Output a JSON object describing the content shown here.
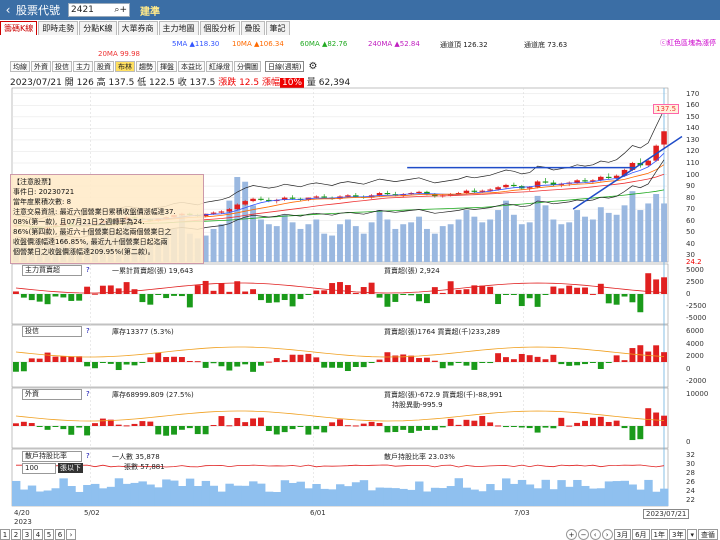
{
  "header": {
    "back_icon": "‹",
    "title": "股票代號",
    "code": "2421",
    "stock_name": "建準"
  },
  "tabs": [
    "籌碼K線",
    "即時走勢",
    "分點K線",
    "大單券商",
    "主力地圖",
    "個股分析",
    "疊股",
    "筆記"
  ],
  "ma": {
    "ma5": "5MA ▲118.30",
    "ma10": "10MA ▲106.34",
    "ma60": "60MA ▲82.76",
    "ma240": "240MA ▲52.84",
    "ch_top": "通道頂 126.32",
    "ch_bot": "通道底 73.63",
    "ma20": "20MA 99.98",
    "mark": "ⓒ紅色區塊為漲停",
    "colors": {
      "ma5": "#3355ff",
      "ma10": "#ff6a00",
      "ma60": "#22aa22",
      "ma240": "#c020c0",
      "ma20": "#ee3333",
      "ch": "#222222"
    }
  },
  "toolbar": {
    "buttons": [
      "均線",
      "外資",
      "投信",
      "主力",
      "股資",
      "布林",
      "趨勢",
      "揮盤",
      "本益比",
      "紅綠燈",
      "分價圖"
    ],
    "selected": "布林",
    "period": "日線(週期)"
  },
  "quote": {
    "date": "2023/07/21",
    "open": "開 126",
    "high": "高 137.5",
    "low": "低 122.5",
    "close": "收 137.5",
    "change": "漲跌 12.5",
    "pct_label": "漲幅",
    "pct": "10%",
    "volume": "量 62,394"
  },
  "note": {
    "lines": [
      "【注意股票】",
      "事件日: 20230721",
      "當年度累積次數: 8",
      "注意交易資訊: 最近六個營業日累積收盤價漲幅達37.",
      "08%(第一款), 且07月21日之週轉率為24.",
      "86%(第四款), 最近六十個營業日起迄兩個營業日之",
      "收盤價漲幅達166.85%, 最近九十個營業日起迄兩",
      "個營業日之收盤價漲幅達209.95%(第二款)。"
    ]
  },
  "price_axis": [
    "170",
    "160",
    "150",
    "140",
    "130",
    "120",
    "110",
    "100",
    "90",
    "80",
    "70",
    "60",
    "50",
    "40",
    "30"
  ],
  "price_badge": "137.5",
  "price_low_badge": "24.2",
  "panels": [
    {
      "select": "主力買賣超",
      "t1": "一累計買賣超(張) 19,643",
      "t2": "買賣超(張) 2,924",
      "axis": [
        "5000",
        "2500",
        "0",
        "-2500",
        "-5000"
      ]
    },
    {
      "select": "投信",
      "t1": "庫存13377 (5.3%)",
      "t2": "買賣超(張)1764 買賣超(千)233,289",
      "axis": [
        "6000",
        "4000",
        "2000",
        "0",
        "-2000"
      ]
    },
    {
      "select": "外資",
      "t1": "庫存68999.809 (27.5%)",
      "t2": "買賣超(張)-672.9 買賣超(千)-88,991",
      "t3": "持股異動-995.9",
      "axis": [
        "10000",
        "0"
      ]
    },
    {
      "select": "散戶持股比率",
      "t1": "一人數 35,878",
      "t1b": "張數 57,881",
      "t2": "散戶持股比率 23.03%",
      "axis": [
        "32",
        "30",
        "28",
        "26",
        "24",
        "22"
      ],
      "sub_select": "100",
      "sub_label": "張以下"
    }
  ],
  "x_axis": {
    "labels": [
      "4/20",
      "5/02",
      "6/01",
      "7/03"
    ],
    "year": "2023",
    "current": "2023/07/21"
  },
  "pager": {
    "pages": [
      "1",
      "2",
      "3",
      "4",
      "5",
      "6"
    ],
    "next": "›"
  },
  "range": {
    "items": [
      "3月",
      "6月",
      "1年",
      "3年"
    ],
    "more": "▾",
    "exit": "查循"
  },
  "chart_data": {
    "type": "candlestick",
    "ohlc": [
      [
        55,
        57,
        54,
        56
      ],
      [
        56,
        58,
        55,
        55
      ],
      [
        55,
        56,
        53,
        54
      ],
      [
        54,
        55,
        52,
        53
      ],
      [
        53,
        56,
        52,
        55
      ],
      [
        55,
        57,
        54,
        56
      ],
      [
        56,
        58,
        55,
        58
      ],
      [
        58,
        59,
        56,
        56
      ],
      [
        56,
        57,
        54,
        55
      ],
      [
        55,
        57,
        54,
        57
      ],
      [
        57,
        59,
        56,
        58
      ],
      [
        58,
        61,
        57,
        60
      ],
      [
        60,
        62,
        58,
        59
      ],
      [
        59,
        61,
        58,
        61
      ],
      [
        61,
        64,
        60,
        63
      ],
      [
        63,
        64,
        61,
        62
      ],
      [
        62,
        63,
        60,
        61
      ],
      [
        61,
        62,
        59,
        60
      ],
      [
        60,
        62,
        59,
        62
      ],
      [
        62,
        64,
        61,
        63
      ],
      [
        63,
        65,
        62,
        65
      ],
      [
        65,
        67,
        64,
        66
      ],
      [
        66,
        67,
        64,
        65
      ],
      [
        65,
        66,
        63,
        64
      ],
      [
        64,
        66,
        63,
        66
      ],
      [
        66,
        68,
        65,
        67
      ],
      [
        67,
        69,
        66,
        68
      ],
      [
        68,
        71,
        67,
        70
      ],
      [
        70,
        75,
        69,
        74
      ],
      [
        74,
        78,
        73,
        77
      ],
      [
        77,
        80,
        76,
        79
      ],
      [
        79,
        81,
        77,
        78
      ],
      [
        78,
        80,
        76,
        77
      ],
      [
        77,
        79,
        75,
        78
      ],
      [
        78,
        81,
        77,
        80
      ],
      [
        80,
        82,
        78,
        79
      ],
      [
        79,
        80,
        77,
        78
      ],
      [
        78,
        80,
        77,
        80
      ],
      [
        80,
        82,
        79,
        81
      ],
      [
        81,
        83,
        79,
        80
      ],
      [
        80,
        81,
        78,
        79
      ],
      [
        79,
        82,
        78,
        81
      ],
      [
        81,
        83,
        80,
        82
      ],
      [
        82,
        84,
        80,
        81
      ],
      [
        81,
        82,
        79,
        80
      ],
      [
        80,
        83,
        79,
        82
      ],
      [
        82,
        85,
        81,
        84
      ],
      [
        84,
        86,
        82,
        83
      ],
      [
        83,
        85,
        81,
        82
      ],
      [
        82,
        84,
        80,
        83
      ],
      [
        83,
        85,
        82,
        84
      ],
      [
        84,
        86,
        83,
        85
      ],
      [
        85,
        86,
        82,
        83
      ],
      [
        83,
        84,
        80,
        81
      ],
      [
        81,
        83,
        80,
        82
      ],
      [
        82,
        84,
        81,
        83
      ],
      [
        83,
        85,
        82,
        84
      ],
      [
        84,
        87,
        83,
        86
      ],
      [
        86,
        88,
        84,
        85
      ],
      [
        85,
        87,
        84,
        86
      ],
      [
        86,
        88,
        85,
        87
      ],
      [
        87,
        90,
        86,
        89
      ],
      [
        89,
        92,
        88,
        91
      ],
      [
        91,
        93,
        89,
        90
      ],
      [
        90,
        91,
        87,
        88
      ],
      [
        88,
        90,
        86,
        89
      ],
      [
        89,
        95,
        88,
        94
      ],
      [
        94,
        97,
        92,
        93
      ],
      [
        93,
        95,
        90,
        91
      ],
      [
        91,
        93,
        89,
        92
      ],
      [
        92,
        94,
        90,
        93
      ],
      [
        93,
        96,
        92,
        95
      ],
      [
        95,
        97,
        93,
        94
      ],
      [
        94,
        96,
        92,
        95
      ],
      [
        95,
        99,
        94,
        98
      ],
      [
        98,
        101,
        96,
        97
      ],
      [
        97,
        100,
        96,
        99
      ],
      [
        99,
        105,
        98,
        104
      ],
      [
        104,
        111,
        103,
        110
      ],
      [
        110,
        114,
        106,
        108
      ],
      [
        108,
        113,
        107,
        112
      ],
      [
        112,
        126,
        111,
        125
      ],
      [
        126,
        137.5,
        122.5,
        137.5
      ]
    ],
    "volume": [
      20,
      18,
      15,
      22,
      25,
      18,
      30,
      20,
      15,
      22,
      28,
      45,
      35,
      30,
      40,
      25,
      20,
      18,
      22,
      30,
      35,
      50,
      30,
      25,
      28,
      35,
      40,
      65,
      90,
      85,
      60,
      45,
      40,
      38,
      50,
      42,
      35,
      40,
      45,
      30,
      28,
      40,
      45,
      38,
      30,
      42,
      55,
      45,
      35,
      40,
      42,
      48,
      35,
      30,
      38,
      40,
      45,
      55,
      48,
      42,
      45,
      55,
      65,
      50,
      40,
      42,
      70,
      60,
      45,
      40,
      42,
      55,
      48,
      45,
      58,
      52,
      50,
      60,
      75,
      55,
      62,
      72,
      62
    ],
    "ylim": [
      24.2,
      175
    ],
    "x_labels": [
      "4/20",
      "5/02",
      "6/01",
      "7/03",
      "2023/07/21"
    ]
  }
}
